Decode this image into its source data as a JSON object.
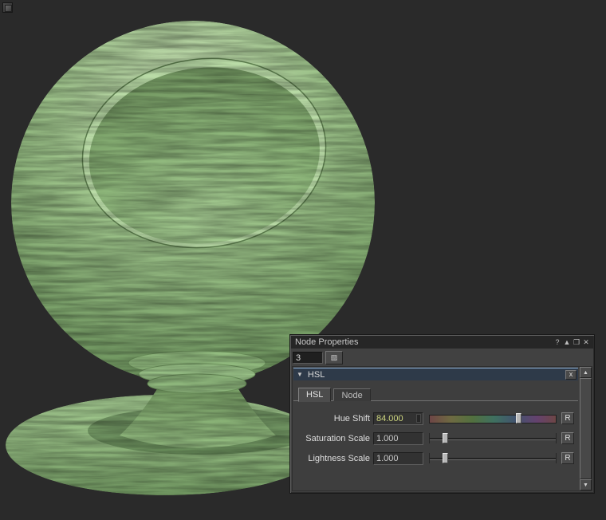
{
  "viewport": {
    "background": "#2a2a2a",
    "object": "material-preview-sphere",
    "material_base_color": "#8fbb7d"
  },
  "node_properties": {
    "title": "Node Properties",
    "titlebar_icons": {
      "help": "?",
      "pin": "▲",
      "restore": "❐",
      "close": "✕"
    },
    "node_index": "3",
    "toolbar_icon": "▨",
    "section": {
      "collapse": "▼",
      "title": "HSL",
      "close": "x",
      "accent_color": "#8fb2d8"
    },
    "tabs": [
      {
        "label": "HSL"
      },
      {
        "label": "Node"
      }
    ],
    "rows": [
      {
        "label": "Hue Shift",
        "value": "84.000",
        "value_color": "#ccd47e",
        "reset": "R",
        "handle_pos": "70%",
        "slider": "hue"
      },
      {
        "label": "Saturation Scale",
        "value": "1.000",
        "value_color": "#c8c8c8",
        "reset": "R",
        "handle_pos": "12%",
        "slider": "plain"
      },
      {
        "label": "Lightness Scale",
        "value": "1.000",
        "value_color": "#c8c8c8",
        "reset": "R",
        "handle_pos": "12%",
        "slider": "plain"
      }
    ],
    "scrollbar": {
      "up": "▲",
      "down": "▼"
    }
  }
}
